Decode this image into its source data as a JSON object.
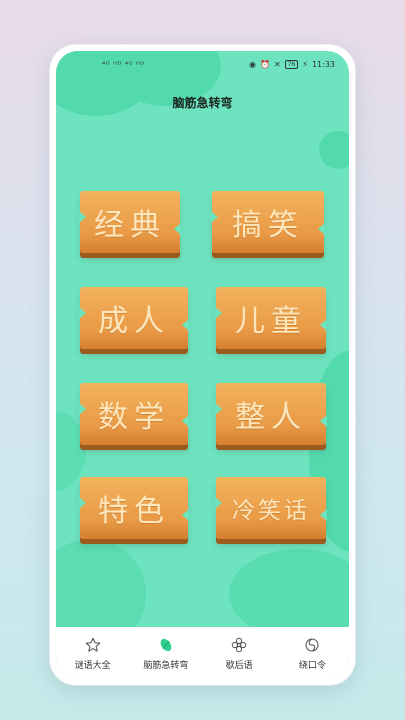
{
  "status_bar": {
    "signal": "⁴ᴳ ᴴᴰ ⁴ᴳ ᴴᴰ",
    "battery": "76",
    "time": "11:33"
  },
  "page": {
    "title": "脑筋急转弯"
  },
  "categories": [
    {
      "label": "经典"
    },
    {
      "label": "搞笑"
    },
    {
      "label": "成人"
    },
    {
      "label": "儿童"
    },
    {
      "label": "数学"
    },
    {
      "label": "整人"
    },
    {
      "label": "特色"
    },
    {
      "label": "冷笑话"
    }
  ],
  "tabs": [
    {
      "label": "谜语大全",
      "icon": "star-icon"
    },
    {
      "label": "脑筋急转弯",
      "icon": "leaf-icon",
      "active": true
    },
    {
      "label": "歇后语",
      "icon": "flower-icon"
    },
    {
      "label": "绕口令",
      "icon": "swirl-icon"
    }
  ],
  "colors": {
    "accent": "#52d9ac",
    "screen_bg": "#6ee3bf",
    "tile": "#eba04a",
    "tile_text": "#fde6bc"
  }
}
